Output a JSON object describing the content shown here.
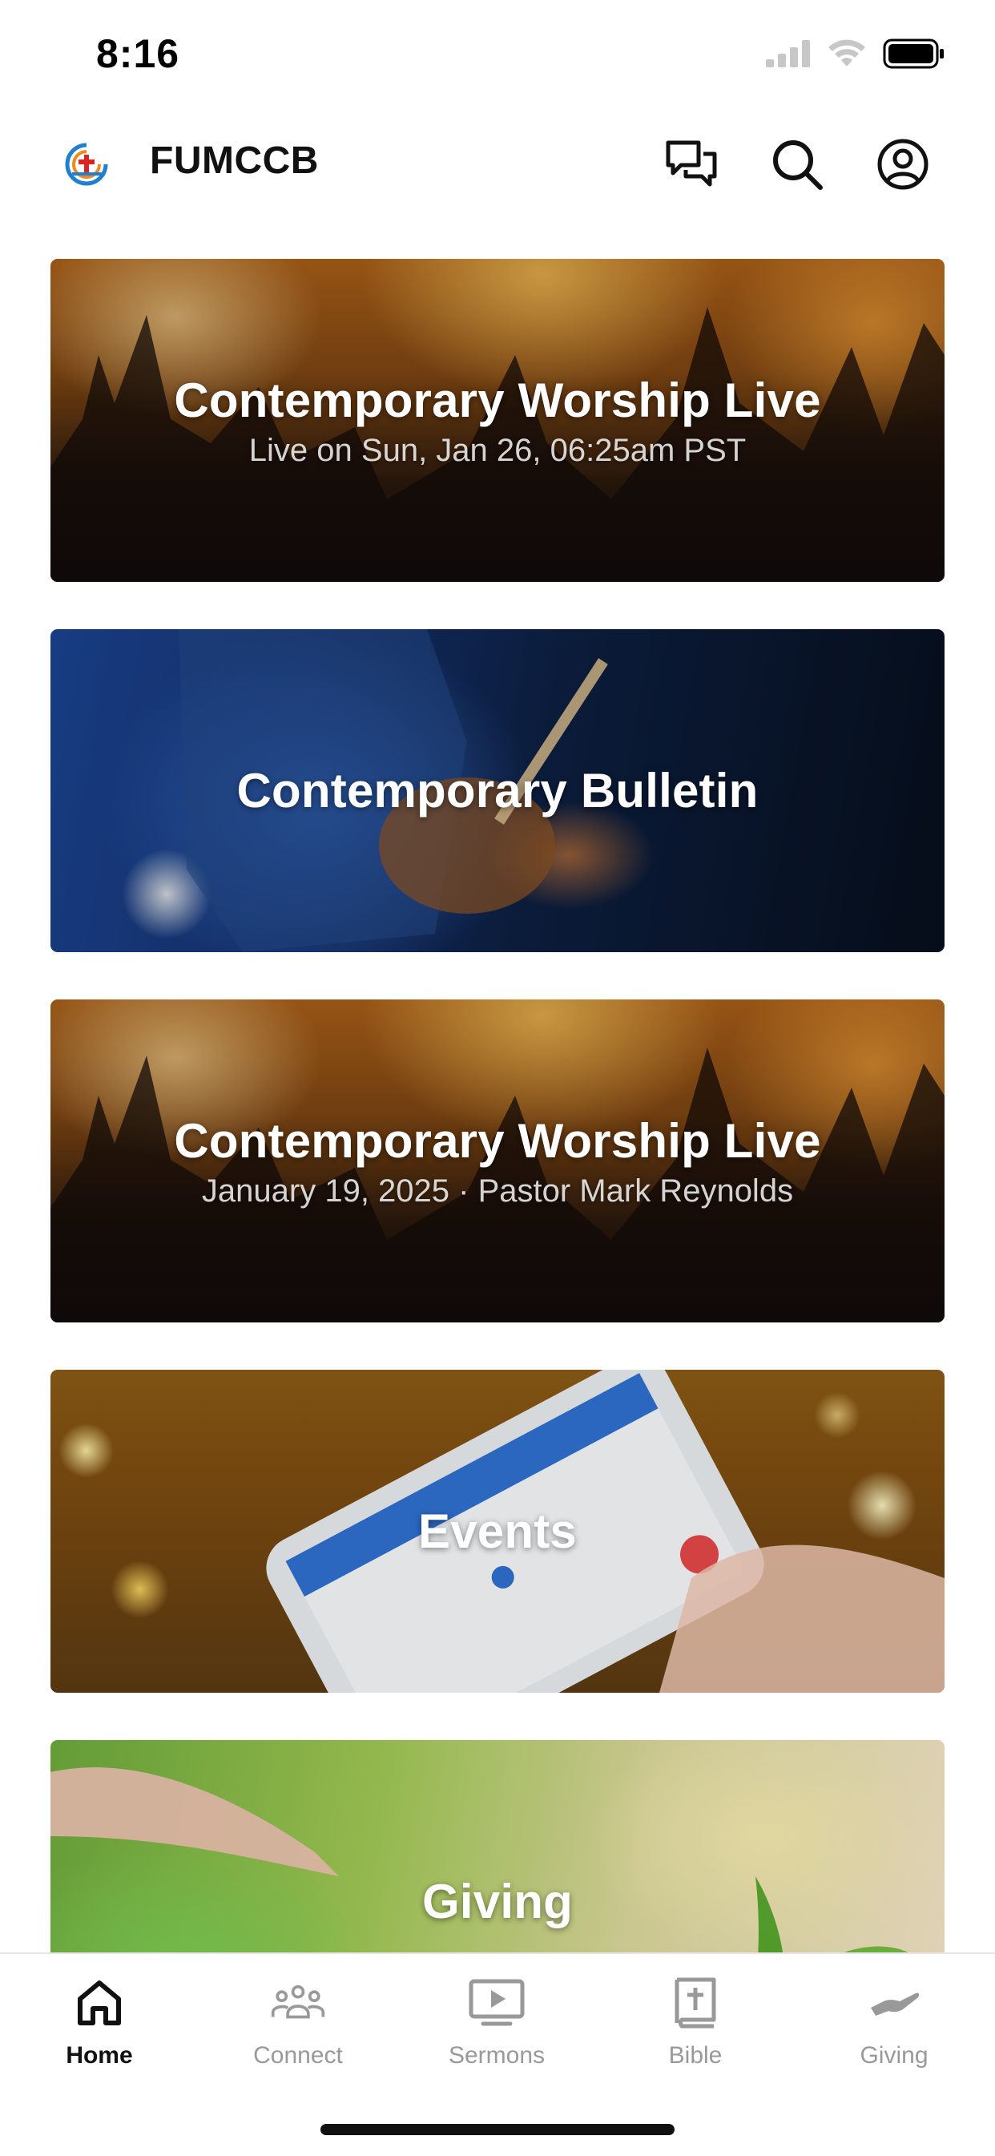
{
  "status_bar": {
    "time": "8:16"
  },
  "header": {
    "title": "FUMCCB"
  },
  "cards": [
    {
      "title": "Contemporary Worship Live",
      "subtitle": "Live on Sun, Jan 26, 06:25am PST"
    },
    {
      "title": "Contemporary Bulletin",
      "subtitle": ""
    },
    {
      "title": "Contemporary Worship Live",
      "subtitle": "January 19, 2025 · Pastor Mark Reynolds"
    },
    {
      "title": "Events",
      "subtitle": ""
    },
    {
      "title": "Giving",
      "subtitle": ""
    }
  ],
  "tab_bar": {
    "items": [
      {
        "label": "Home",
        "icon": "home-icon",
        "active": true
      },
      {
        "label": "Connect",
        "icon": "people-icon",
        "active": false
      },
      {
        "label": "Sermons",
        "icon": "video-icon",
        "active": false
      },
      {
        "label": "Bible",
        "icon": "bible-icon",
        "active": false
      },
      {
        "label": "Giving",
        "icon": "giving-hand-icon",
        "active": false
      }
    ]
  },
  "colors": {
    "active_tab": "#111111",
    "inactive_tab": "#999999",
    "background": "#ffffff"
  }
}
